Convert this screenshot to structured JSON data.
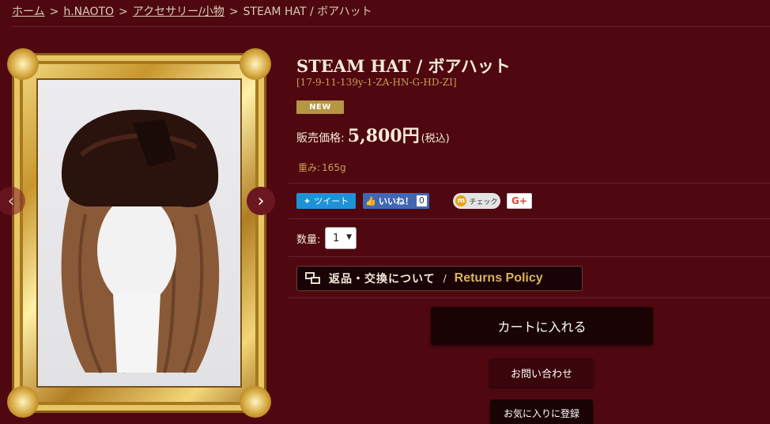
{
  "breadcrumb": {
    "items": [
      "ホーム",
      "h.NAOTO",
      "アクセサリー/小物"
    ],
    "separator": ">",
    "current": "STEAM HAT / ボアハット"
  },
  "product": {
    "title": "STEAM HAT / ボアハット",
    "sku": "[17-9-11-139y-1-ZA-HN-G-HD-ZI]",
    "badge": "NEW",
    "price_label": "販売価格:",
    "price_value": "5,800円",
    "price_tax": "(税込)",
    "weight_label": "重み:",
    "weight_value": "165g"
  },
  "gallery": {
    "prev_icon": "‹",
    "next_icon": "›"
  },
  "social": {
    "tweet": "ツイート",
    "like": "いいね！",
    "like_count": "0",
    "mixi_check": "チェック",
    "mixi_m": "m",
    "gplus": "G+"
  },
  "quantity": {
    "label": "数量:",
    "value": "1"
  },
  "policy": {
    "jp": "返品・交換について",
    "slash": "/",
    "en": "Returns Policy"
  },
  "buttons": {
    "cart": "カートに入れる",
    "inquiry": "お問い合わせ",
    "favorite": "お気に入りに登録"
  },
  "colors": {
    "background": "#4f0810",
    "accent_gold": "#c99f55",
    "badge": "#b69543"
  }
}
